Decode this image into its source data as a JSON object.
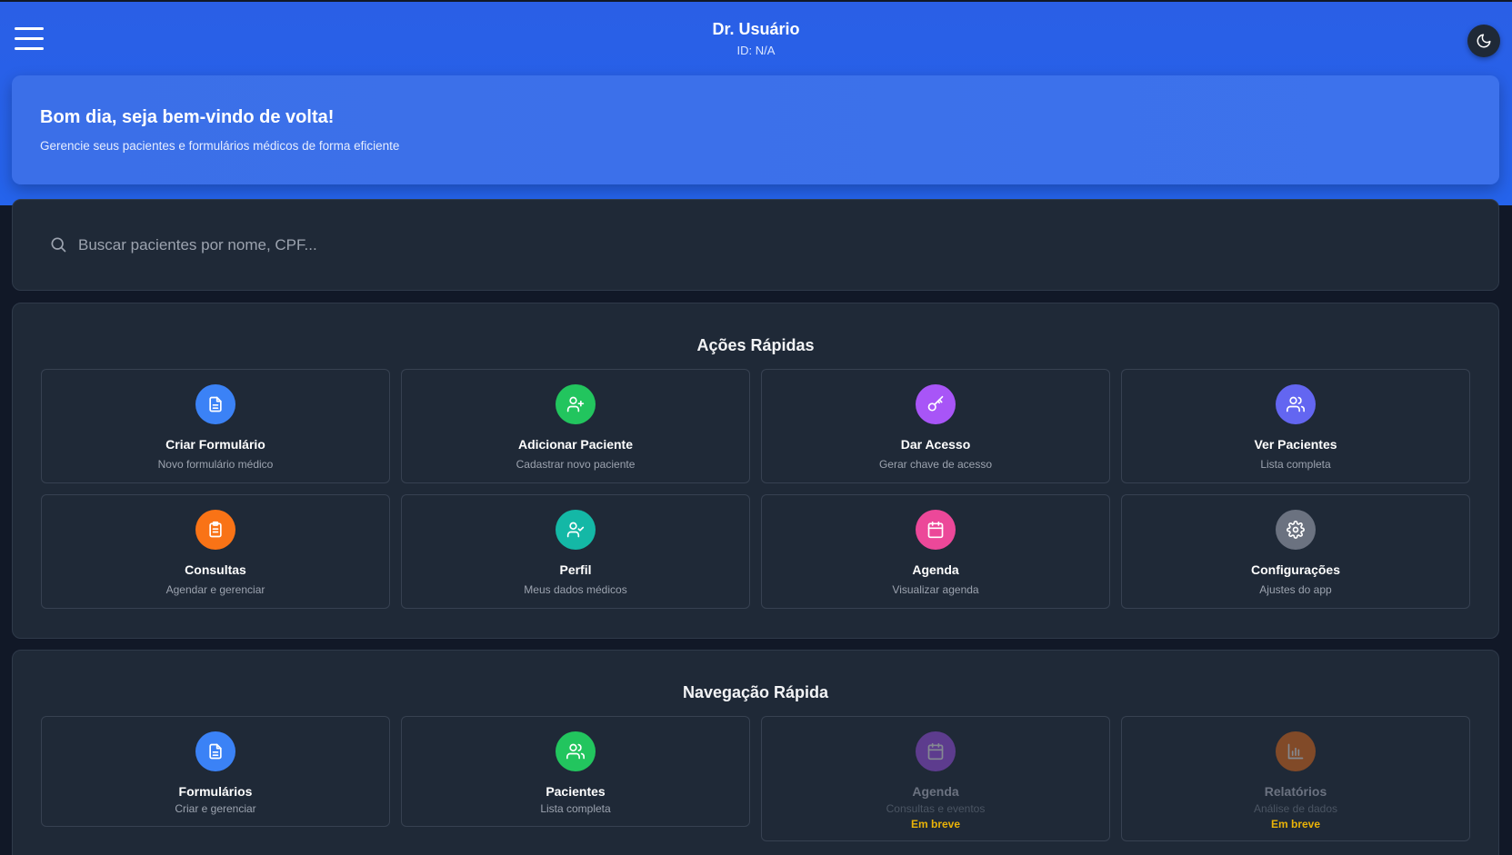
{
  "header": {
    "user_name": "Dr. Usuário",
    "user_id": "ID: N/A",
    "menu_icon": "hamburger-menu-icon",
    "theme_icon": "moon-icon"
  },
  "welcome": {
    "title": "Bom dia, seja bem-vindo de volta!",
    "subtitle": "Gerencie seus pacientes e formulários médicos de forma eficiente"
  },
  "search": {
    "placeholder": "Buscar pacientes por nome, CPF...",
    "value": ""
  },
  "quick_actions": {
    "title": "Ações Rápidas",
    "items": [
      {
        "title": "Criar Formulário",
        "subtitle": "Novo formulário médico",
        "icon": "file-text-icon",
        "color": "#3b82f6"
      },
      {
        "title": "Adicionar Paciente",
        "subtitle": "Cadastrar novo paciente",
        "icon": "user-plus-icon",
        "color": "#22c55e"
      },
      {
        "title": "Dar Acesso",
        "subtitle": "Gerar chave de acesso",
        "icon": "key-icon",
        "color": "#a855f7"
      },
      {
        "title": "Ver Pacientes",
        "subtitle": "Lista completa",
        "icon": "users-icon",
        "color": "#6366f1"
      },
      {
        "title": "Consultas",
        "subtitle": "Agendar e gerenciar",
        "icon": "clipboard-icon",
        "color": "#f97316"
      },
      {
        "title": "Perfil",
        "subtitle": "Meus dados médicos",
        "icon": "user-check-icon",
        "color": "#14b8a6"
      },
      {
        "title": "Agenda",
        "subtitle": "Visualizar agenda",
        "icon": "calendar-icon",
        "color": "#ec4899"
      },
      {
        "title": "Configurações",
        "subtitle": "Ajustes do app",
        "icon": "gear-icon",
        "color": "#6b7280"
      }
    ]
  },
  "quick_nav": {
    "title": "Navegação Rápida",
    "items": [
      {
        "title": "Formulários",
        "subtitle": "Criar e gerenciar",
        "icon": "file-text-icon",
        "color": "#3b82f6",
        "badge": ""
      },
      {
        "title": "Pacientes",
        "subtitle": "Lista completa",
        "icon": "users-icon",
        "color": "#22c55e",
        "badge": ""
      },
      {
        "title": "Agenda",
        "subtitle": "Consultas e eventos",
        "icon": "calendar-icon",
        "color": "#a855f7",
        "badge": "Em breve"
      },
      {
        "title": "Relatórios",
        "subtitle": "Análise de dados",
        "icon": "bar-chart-icon",
        "color": "#f97316",
        "badge": "Em breve"
      }
    ]
  }
}
